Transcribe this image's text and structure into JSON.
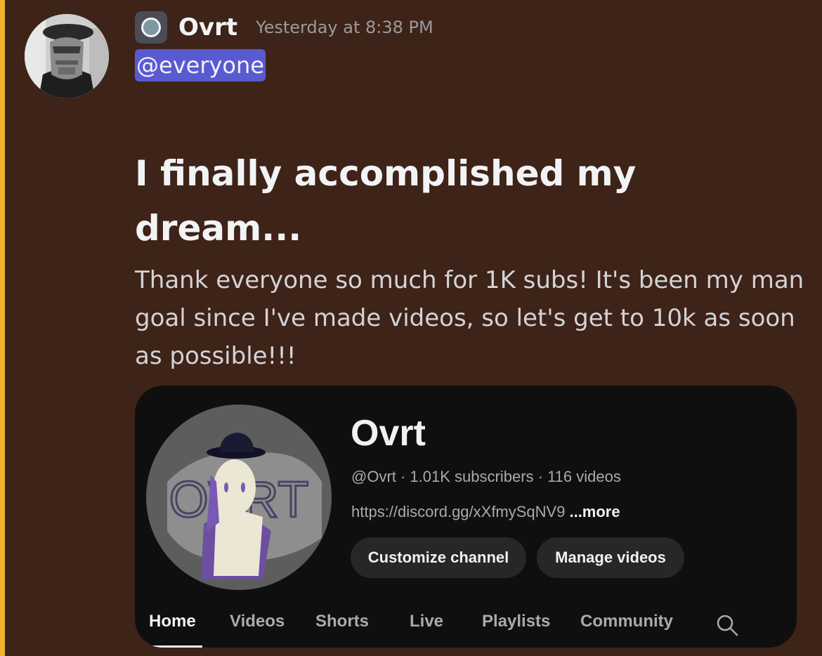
{
  "message": {
    "username": "Ovrt",
    "timestamp": "Yesterday at 8:38 PM",
    "mention": "@everyone",
    "heading": "I finally accomplished my dream...",
    "body": "Thank everyone so much for 1K subs! It's been my man goal since I've made videos, so let's get to 10k as soon as possible!!!"
  },
  "embed": {
    "channel_name": "Ovrt",
    "channel_meta": "@Ovrt · 1.01K subscribers · 116 videos",
    "channel_link": "https://discord.gg/xXfmySqNV9",
    "more_label": "...more",
    "customize_label": "Customize channel",
    "manage_label": "Manage videos",
    "avatar_text": "OVRT",
    "tabs": [
      {
        "label": "Home"
      },
      {
        "label": "Videos"
      },
      {
        "label": "Shorts"
      },
      {
        "label": "Live"
      },
      {
        "label": "Playlists"
      },
      {
        "label": "Community"
      }
    ]
  },
  "colors": {
    "background": "#3e2318",
    "accent_bar": "#f0b232",
    "mention_bg": "#5a5ad0",
    "card_bg": "#0f0f0f"
  }
}
